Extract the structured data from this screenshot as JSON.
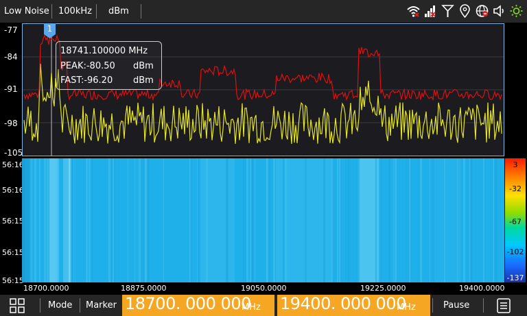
{
  "topbar": {
    "mode": "Low Noise",
    "rbw": "100kHz",
    "unit": "dBm",
    "icons": [
      "wifi-off-icon",
      "signal-off-icon",
      "antenna-icon",
      "location-icon",
      "globe-no-icon",
      "speaker-icon",
      "sun-icon"
    ]
  },
  "spectrum": {
    "y_ticks": [
      "-77",
      "-84",
      "-91",
      "-98",
      "-105"
    ],
    "marker": {
      "number": "1",
      "freq": "18741.100000 MHz",
      "peak_label": "PEAK:-80.50",
      "peak_unit": "dBm",
      "fast_label": "FAST:-96.20",
      "fast_unit": "dBm"
    }
  },
  "waterfall": {
    "times": [
      "56:16",
      "56:16",
      "56:15",
      "56:15",
      "56:15"
    ],
    "colorbar_ticks": [
      "3",
      "-32",
      "-67",
      "-102",
      "-137"
    ]
  },
  "x_ticks": [
    "18700.0000",
    "18875.0000",
    "19050.0000",
    "19225.0000",
    "19400.0000"
  ],
  "bottombar": {
    "mode_label": "Mode",
    "marker_label": "Marker",
    "start_freq": "18700. 000 000",
    "stop_freq": "19400. 000 000",
    "freq_unit": "MHz",
    "pause_label": "Pause"
  },
  "colors": {
    "peak_trace": "#e01010",
    "fast_trace": "#e6e62a",
    "accent": "#f5a623",
    "frame": "#7fb8e8"
  }
}
